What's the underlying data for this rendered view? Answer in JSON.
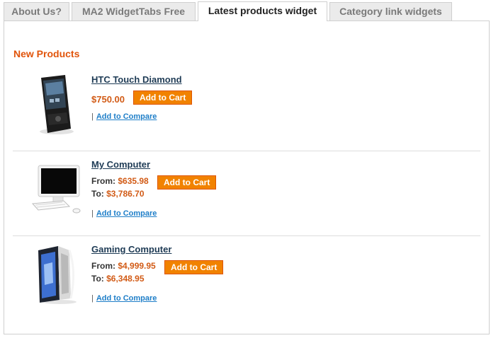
{
  "tabs": [
    {
      "label": "About Us?"
    },
    {
      "label": "MA2 WidgetTabs Free"
    },
    {
      "label": "Latest products widget"
    },
    {
      "label": "Category link widgets"
    }
  ],
  "active_tab": "Latest products widget",
  "section": {
    "title": "New Products"
  },
  "products": [
    {
      "name": "HTC Touch Diamond",
      "price": "$750.00",
      "cart_label": "Add to Cart",
      "separator": "|",
      "compare_label": "Add to Compare"
    },
    {
      "name": "My Computer",
      "from_label": "From:",
      "from_price": "$635.98",
      "to_label": "To:",
      "to_price": "$3,786.70",
      "cart_label": "Add to Cart",
      "separator": "|",
      "compare_label": "Add to Compare"
    },
    {
      "name": "Gaming Computer",
      "from_label": "From:",
      "from_price": "$4,999.95",
      "to_label": "To:",
      "to_price": "$6,348.95",
      "cart_label": "Add to Cart",
      "separator": "|",
      "compare_label": "Add to Compare"
    }
  ],
  "colors": {
    "accent": "#e1540b",
    "button": "#f18200",
    "link": "#1e7ec8",
    "price": "#d25b16"
  }
}
